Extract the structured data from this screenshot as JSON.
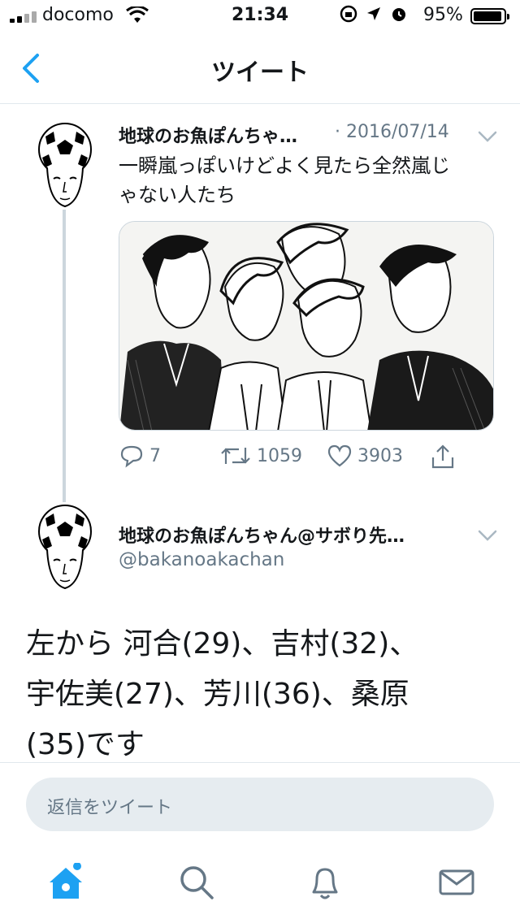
{
  "status_bar": {
    "carrier": "docomo",
    "time": "21:34",
    "battery": "95%",
    "battery_level": 0.95
  },
  "nav": {
    "title": "ツイート",
    "back_icon": "chevron-left-icon"
  },
  "parent_tweet": {
    "name": "地球のお魚ぽんちゃ…",
    "date": "· 2016/07/14",
    "text_line1": "一瞬嵐っぽいけどよく見たら全然嵐じ",
    "text_line2": "ゃない人たち",
    "media_icon": "illustration-image",
    "actions": {
      "reply_count": "7",
      "retweet_count": "1059",
      "like_count": "3903"
    }
  },
  "main_tweet": {
    "name": "地球のお魚ぽんちゃん@サボり先…",
    "handle": "@bakanoakachan",
    "text_line1": "左から 河合(29)、吉村(32)、",
    "text_line2": "宇佐美(27)、芳川(36)、桑原",
    "text_line3": "(35)です"
  },
  "reply": {
    "placeholder": "返信をツイート"
  },
  "tabs": {
    "home_icon": "home-icon",
    "search_icon": "search-icon",
    "notifications_icon": "bell-icon",
    "messages_icon": "mail-icon"
  },
  "colors": {
    "accent": "#1da1f2",
    "secondary_text": "#657786",
    "divider": "#e1e8ed",
    "input_bg": "#e6ecf0"
  }
}
